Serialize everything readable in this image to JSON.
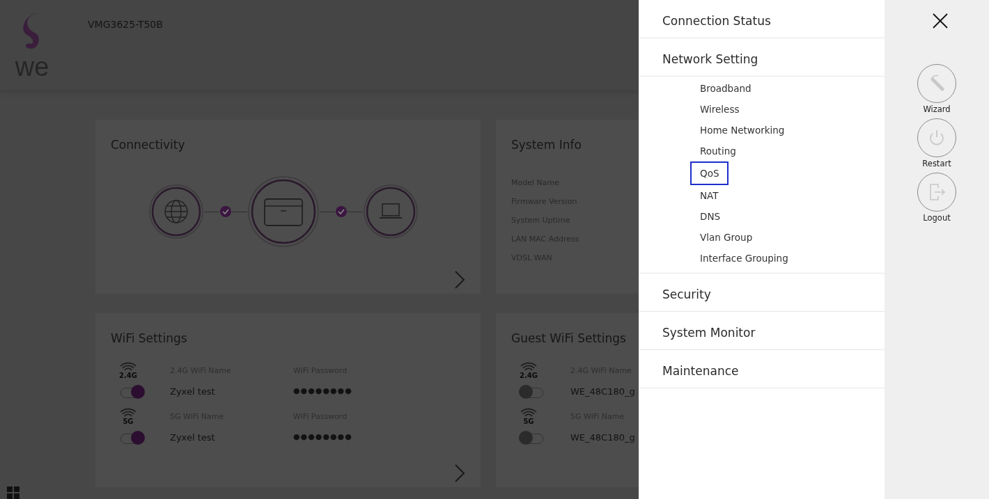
{
  "header": {
    "logo_text": "we",
    "model": "VMG3625-T50B"
  },
  "connectivity": {
    "title": "Connectivity",
    "links": [
      {
        "connected": true
      },
      {
        "connected": true
      }
    ]
  },
  "system_info": {
    "title": "System Info",
    "labels": [
      "Model Name",
      "Firmware Version",
      "System Uptime",
      "LAN MAC Address",
      "VDSL WAN"
    ]
  },
  "wifi": {
    "title": "WiFi Settings",
    "bands": [
      {
        "band": "2.4G",
        "name_label": "2.4G WiFi Name",
        "name": "Zyxel test",
        "password_label": "WiFi Password",
        "password": "●●●●●●●●",
        "on": true
      },
      {
        "band": "5G",
        "name_label": "5G WiFi Name",
        "name": "Zyxel test",
        "password_label": "WiFi Password",
        "password": "●●●●●●●●",
        "on": true
      }
    ]
  },
  "guest_wifi": {
    "title": "Guest WiFi Settings",
    "bands": [
      {
        "band": "2.4G",
        "name_label": "2.4G WiFi Name",
        "name": "WE_48C180_g",
        "on": false
      },
      {
        "band": "5G",
        "name_label": "5G WiFi Name",
        "name": "WE_48C180_g",
        "on": false
      }
    ]
  },
  "menu": {
    "sections": [
      {
        "label": "Connection Status"
      },
      {
        "label": "Network Setting",
        "children": [
          {
            "label": "Broadband",
            "selected": false
          },
          {
            "label": "Wireless",
            "selected": false
          },
          {
            "label": "Home Networking",
            "selected": false
          },
          {
            "label": "Routing",
            "selected": false
          },
          {
            "label": "QoS",
            "selected": true
          },
          {
            "label": "NAT",
            "selected": false
          },
          {
            "label": "DNS",
            "selected": false
          },
          {
            "label": "Vlan Group",
            "selected": false
          },
          {
            "label": "Interface Grouping",
            "selected": false
          }
        ]
      },
      {
        "label": "Security"
      },
      {
        "label": "System Monitor"
      },
      {
        "label": "Maintenance"
      }
    ]
  },
  "actions": [
    {
      "kind": "wizard",
      "label": "Wizard"
    },
    {
      "kind": "restart",
      "label": "Restart"
    },
    {
      "kind": "logout",
      "label": "Logout"
    }
  ]
}
